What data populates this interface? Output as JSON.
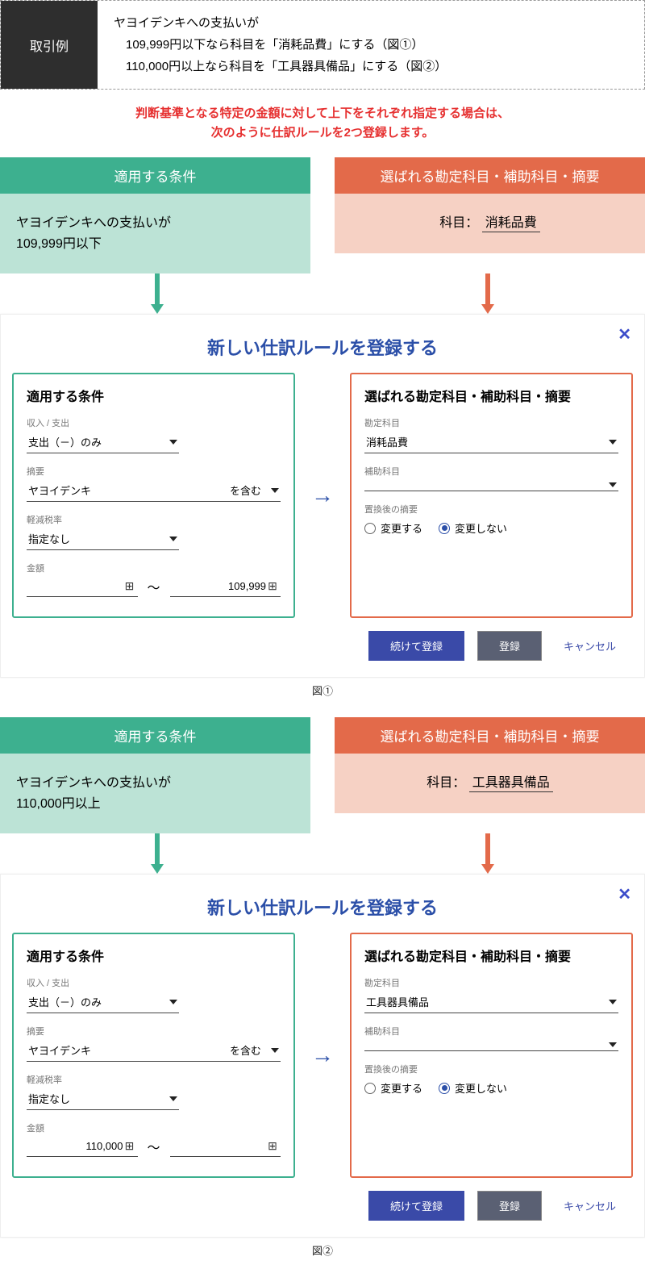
{
  "top": {
    "label": "取引例",
    "line1": "ヤヨイデンキへの支払いが",
    "line2": "　109,999円以下なら科目を「消耗品費」にする（図①）",
    "line3": "　110,000円以上なら科目を「工具器具備品」にする（図②）"
  },
  "redmsg": "判断基準となる特定の金額に対して上下をそれぞれ指定する場合は、\n次のように仕訳ルールを2つ登録します。",
  "colHeads": {
    "left": "適用する条件",
    "right": "選ばれる勘定科目・補助科目・摘要"
  },
  "cond": [
    {
      "text": "ヤヨイデンキへの支払いが\n109,999円以下",
      "subjLabel": "科目：",
      "subjVal": "消耗品費"
    },
    {
      "text": "ヤヨイデンキへの支払いが\n110,000円以上",
      "subjLabel": "科目：",
      "subjVal": "工具器具備品"
    }
  ],
  "dialog": {
    "title": "新しい仕訳ルールを登録する",
    "leftTitle": "適用する条件",
    "rightTitle": "選ばれる勘定科目・補助科目・摘要",
    "labels": {
      "io": "収入 / 支出",
      "ioVal": "支出（－）のみ",
      "desc": "摘要",
      "descVal": "ヤヨイデンキ",
      "descSuffix": "を含む",
      "tax": "軽減税率",
      "taxVal": "指定なし",
      "amount": "金額",
      "account": "勘定科目",
      "sub": "補助科目",
      "after": "置換後の摘要",
      "radioChange": "変更する",
      "radioNoChange": "変更しない"
    }
  },
  "rules": [
    {
      "amountFrom": "",
      "amountTo": "109,999",
      "accountVal": "消耗品費"
    },
    {
      "amountFrom": "110,000",
      "amountTo": "",
      "accountVal": "工具器具備品"
    }
  ],
  "buttons": {
    "continue": "続けて登録",
    "register": "登録",
    "cancel": "キャンセル"
  },
  "figs": [
    "図①",
    "図②"
  ]
}
